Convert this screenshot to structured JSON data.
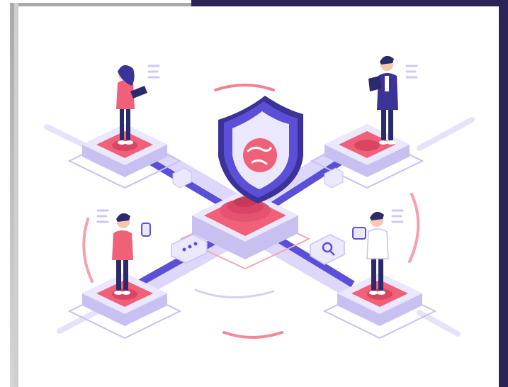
{
  "scene": {
    "subject": "isometric-network-security-illustration",
    "icons": [
      "shield-icon",
      "globe-icon",
      "chat-bubble-icon",
      "search-icon"
    ],
    "colors": {
      "frame_dark": "#2c2356",
      "card": "#ffffff",
      "platform_top": "#e8e3fb",
      "platform_side": "#c9c0f2",
      "accent_pink": "#f06078",
      "accent_pink_dark": "#d94563",
      "purple": "#5a4fd6",
      "purple_dark": "#3c3399",
      "figure_dark": "#2b2a6b",
      "skin": "#f8c7ae"
    }
  }
}
